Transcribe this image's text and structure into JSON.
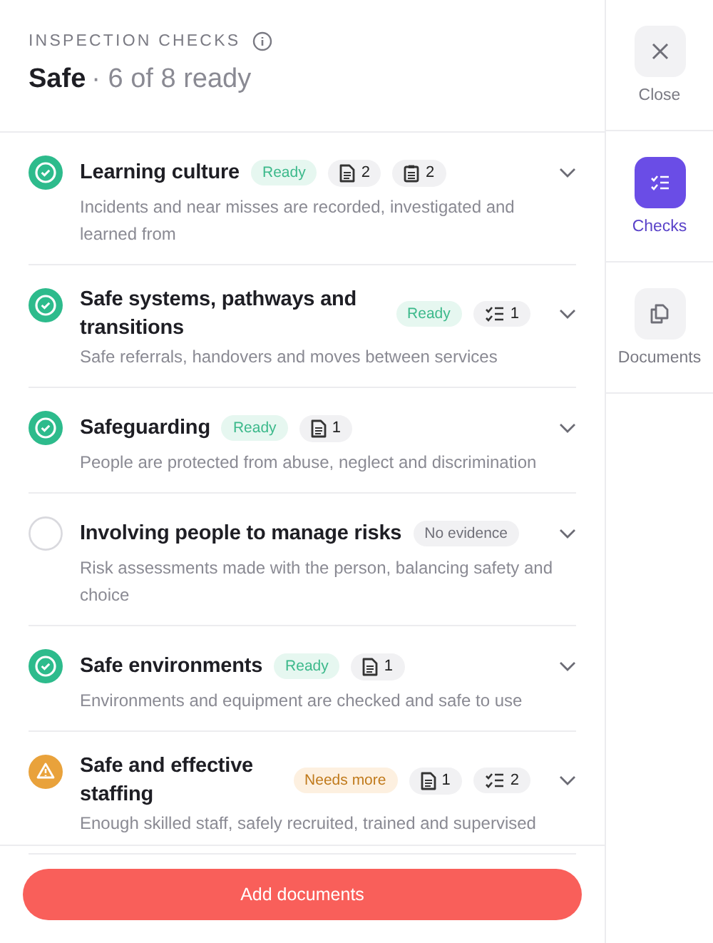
{
  "header": {
    "eyebrow": "INSPECTION CHECKS",
    "title": "Safe",
    "summary": "· 6 of 8 ready"
  },
  "checks": [
    {
      "kind": "ready",
      "title": "Learning culture",
      "badge": "Ready",
      "chips": [
        {
          "kind": "document",
          "count": "2"
        },
        {
          "kind": "clipboard",
          "count": "2"
        }
      ],
      "description": "Incidents and near misses are recorded, investigated and learned from"
    },
    {
      "kind": "ready",
      "title": "Safe systems, pathways and transitions",
      "badge": "Ready",
      "chips": [
        {
          "kind": "checklist",
          "count": "1"
        }
      ],
      "description": "Safe referrals, handovers and moves between services"
    },
    {
      "kind": "ready",
      "title": "Safeguarding",
      "badge": "Ready",
      "chips": [
        {
          "kind": "document",
          "count": "1"
        }
      ],
      "description": "People are protected from abuse, neglect and discrimination"
    },
    {
      "kind": "none",
      "title": "Involving people to manage risks",
      "badge": "No evidence",
      "description": "Risk assessments made with the person, balancing safety and choice"
    },
    {
      "kind": "ready",
      "title": "Safe environments",
      "badge": "Ready",
      "chips": [
        {
          "kind": "document",
          "count": "1"
        }
      ],
      "description": "Environments and equipment are checked and safe to use"
    },
    {
      "kind": "warning",
      "title": "Safe and effective staffing",
      "badge": "Needs more",
      "chips": [
        {
          "kind": "document",
          "count": "1"
        },
        {
          "kind": "checklist",
          "count": "2"
        }
      ],
      "description": "Enough skilled staff, safely recruited, trained and supervised"
    }
  ],
  "footer": {
    "button": "Add documents"
  },
  "rail": [
    {
      "kind": "close",
      "label": "Close",
      "selected": false
    },
    {
      "kind": "checks",
      "label": "Checks",
      "selected": true
    },
    {
      "kind": "documents",
      "label": "Documents",
      "selected": false
    }
  ]
}
